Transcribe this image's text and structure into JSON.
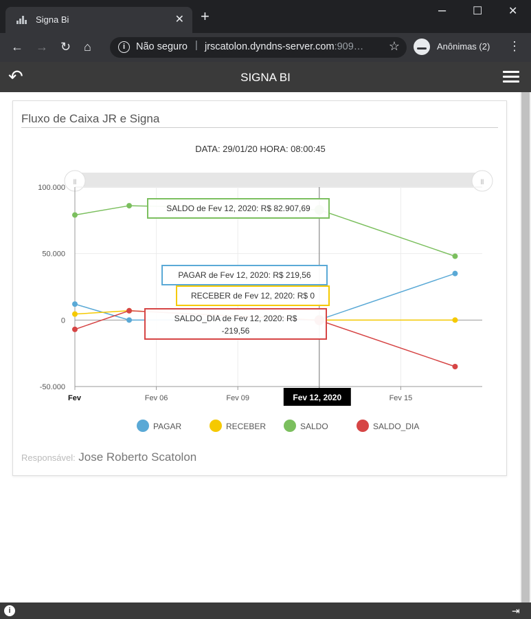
{
  "browser": {
    "tab_title": "Signa Bi",
    "security_label": "Não seguro",
    "url_host": "jrscatolon.dyndns-server.com",
    "url_rest": ":909…",
    "incognito_label": "Anônimas (2)"
  },
  "app": {
    "title": "SIGNA BI"
  },
  "card": {
    "title": "Fluxo de Caixa JR e Signa",
    "datetime": "DATA: 29/01/20 HORA: 08:00:45",
    "responsible_label": "Responsável:",
    "responsible_name": "Jose Roberto Scatolon"
  },
  "colors": {
    "PAGAR": "#5aa9d6",
    "RECEBER": "#f5c900",
    "SALDO": "#7bbf5e",
    "SALDO_DIA": "#d64545"
  },
  "chart_data": {
    "type": "line",
    "x_ticks": [
      "Fev",
      "Fev 06",
      "Fev 09",
      "Fev 12, 2020",
      "Fev 15"
    ],
    "x_tick_values": [
      "2020-02-03",
      "2020-02-06",
      "2020-02-09",
      "2020-02-12",
      "2020-02-15"
    ],
    "x_range": [
      "2020-02-03",
      "2020-02-18"
    ],
    "y_ticks": [
      "100.000",
      "50.000",
      "0",
      "-50.000"
    ],
    "y_tick_values": [
      100000,
      50000,
      0,
      -50000
    ],
    "ylim": [
      -50000,
      100000
    ],
    "grid": true,
    "legend_position": "bottom",
    "highlighted_x": "2020-02-12",
    "series": [
      {
        "name": "PAGAR",
        "points": [
          [
            "2020-02-03",
            12000
          ],
          [
            "2020-02-05",
            0
          ],
          [
            "2020-02-12",
            219.56
          ],
          [
            "2020-02-17",
            35000
          ]
        ]
      },
      {
        "name": "RECEBER",
        "points": [
          [
            "2020-02-03",
            4500
          ],
          [
            "2020-02-05",
            7000
          ],
          [
            "2020-02-12",
            0
          ],
          [
            "2020-02-17",
            0
          ]
        ]
      },
      {
        "name": "SALDO",
        "points": [
          [
            "2020-02-03",
            79000
          ],
          [
            "2020-02-05",
            86000
          ],
          [
            "2020-02-12",
            82907.69
          ],
          [
            "2020-02-17",
            48000
          ]
        ]
      },
      {
        "name": "SALDO_DIA",
        "points": [
          [
            "2020-02-03",
            -7000
          ],
          [
            "2020-02-05",
            7000
          ],
          [
            "2020-02-12",
            -219.56
          ],
          [
            "2020-02-17",
            -35000
          ]
        ]
      }
    ],
    "tooltips": [
      {
        "series": "SALDO",
        "lines": [
          "SALDO de Fev 12, 2020: R$ 82.907,69"
        ]
      },
      {
        "series": "PAGAR",
        "lines": [
          "PAGAR de Fev 12, 2020: R$ 219,56"
        ]
      },
      {
        "series": "RECEBER",
        "lines": [
          "RECEBER de Fev 12, 2020: R$ 0"
        ]
      },
      {
        "series": "SALDO_DIA",
        "lines": [
          "SALDO_DIA de Fev 12, 2020: R$",
          "-219,56"
        ]
      }
    ],
    "legend": [
      "PAGAR",
      "RECEBER",
      "SALDO",
      "SALDO_DIA"
    ]
  }
}
